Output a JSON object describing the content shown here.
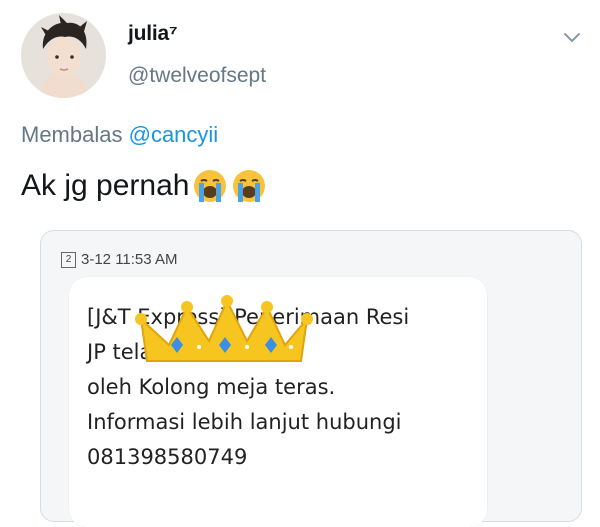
{
  "tweet": {
    "display_name": "julia⁷",
    "handle": "@twelveofsept",
    "reply_prefix": "Membalas",
    "reply_to": "@cancyii",
    "text": "Ak jg pernah",
    "emojis": [
      "loudly-crying-face-icon",
      "loudly-crying-face-icon"
    ]
  },
  "media": {
    "sim_number": "2",
    "timestamp": "3-12 11:53 AM",
    "sms_lines": [
      "[J&T Express] Penerimaan Resi",
      "JP telah diwakilkan",
      "oleh Kolong meja teras.",
      "Informasi lebih lanjut hubungi",
      "081398580749"
    ],
    "overlay_icon": "crown-icon"
  },
  "colors": {
    "name": "#14171a",
    "secondary": "#657786",
    "link": "#1b95e0",
    "card_border": "#d6dde3"
  }
}
